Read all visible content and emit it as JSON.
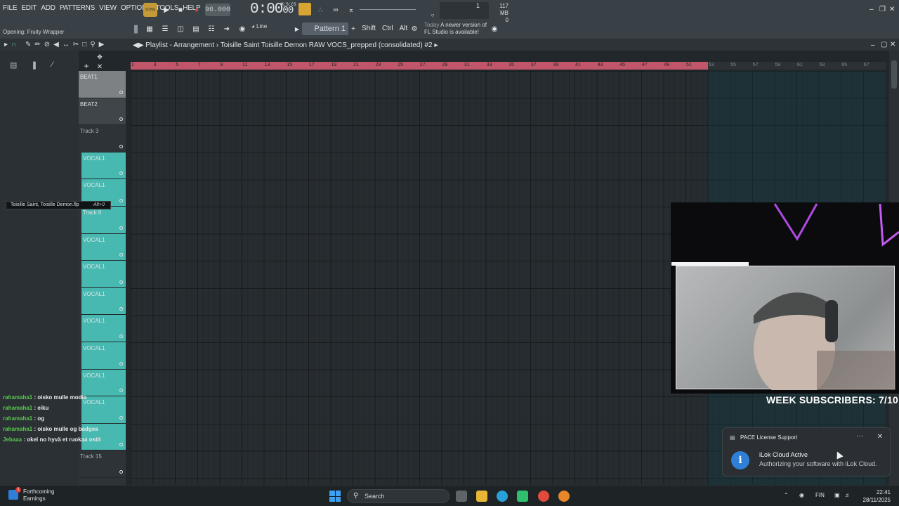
{
  "menu": [
    "FILE",
    "EDIT",
    "ADD",
    "PATTERNS",
    "VIEW",
    "OPTIONS",
    "TOOLS",
    "HELP"
  ],
  "hint": "Opening: Fruity Wrapper",
  "transport": {
    "song_label": "SONG",
    "tempo": "96.000",
    "time": "0:00",
    "time_small": "00",
    "time_unit": "M:S:CS"
  },
  "monitor": {
    "value": "1",
    "mem_mb": "117 MB",
    "mem_count": "0"
  },
  "toolbar2": {
    "line_mode": "Line",
    "pattern": "Pattern 1",
    "mods": [
      "Shift",
      "Ctrl",
      "Alt"
    ],
    "news_when": "Today",
    "news_text_1": "A newer version of",
    "news_text_2": "FL Studio is available!"
  },
  "playlist": {
    "title": "Playlist - Arrangement",
    "project": "Toisille Saint Toisille Demon RAW VOCS_prepped (consolidated) #2"
  },
  "ruler": {
    "labels": [
      "1",
      "3",
      "5",
      "7",
      "9",
      "11",
      "13",
      "15",
      "17",
      "19",
      "21",
      "23",
      "25",
      "27",
      "29",
      "31",
      "33",
      "35",
      "37",
      "39",
      "41",
      "43",
      "45",
      "47",
      "49",
      "51",
      "53",
      "55",
      "57",
      "59",
      "61",
      "63",
      "65",
      "67"
    ],
    "loop_end_bar": 53
  },
  "tracks": [
    {
      "label": "BEAT1",
      "kind": "beat1"
    },
    {
      "label": "BEAT2",
      "kind": "beat2"
    },
    {
      "label": "Track 3",
      "kind": "plain"
    },
    {
      "label": "VOCAL1",
      "kind": "vocal"
    },
    {
      "label": "VOCAL1",
      "kind": "vocal"
    },
    {
      "label": "Track 6",
      "kind": "vocal"
    },
    {
      "label": "VOCAL1",
      "kind": "vocal"
    },
    {
      "label": "VOCAL1",
      "kind": "vocal"
    },
    {
      "label": "VOCAL1",
      "kind": "vocal"
    },
    {
      "label": "VOCAL1",
      "kind": "vocal"
    },
    {
      "label": "VOCAL1",
      "kind": "vocal"
    },
    {
      "label": "VOCAL1",
      "kind": "vocal"
    },
    {
      "label": "VOCAL1",
      "kind": "vocal"
    },
    {
      "label": "",
      "kind": "vocal"
    },
    {
      "label": "Track 15",
      "kind": "plain"
    }
  ],
  "tooltip": {
    "text": "Toisille Saint, Toisille Demon.flp",
    "shortcut": "Alt+0"
  },
  "stream": {
    "week_subs": "WEEK SUBSCRIBERS: 7/10"
  },
  "chat": [
    {
      "user": "rahamaha1",
      "msg": ": oisko mulle modia"
    },
    {
      "user": "rahamaha1",
      "msg": ": eiku"
    },
    {
      "user": "rahamaha1",
      "msg": ": og"
    },
    {
      "user": "rahamaha1",
      "msg": ": oisko mulle og badgea"
    },
    {
      "user": "Jebaaa",
      "msg": ": okei no hyvä et ruokaa ostit"
    }
  ],
  "toast": {
    "app": "PACE License Support",
    "heading": "iLok Cloud Active",
    "body": "Authorizing your software with iLok Cloud."
  },
  "taskbar": {
    "weather_title": "Forthcoming",
    "weather_sub": "Earnings",
    "weather_badge": "1",
    "search_placeholder": "Search",
    "lang": "FIN",
    "time": "22:41",
    "date": "28/11/2025"
  },
  "colors": {
    "loop_red": "#c1566a",
    "vocal_teal": "#47b9b0",
    "chat_user": "#59c84b",
    "info_blue": "#2f7fd8"
  }
}
